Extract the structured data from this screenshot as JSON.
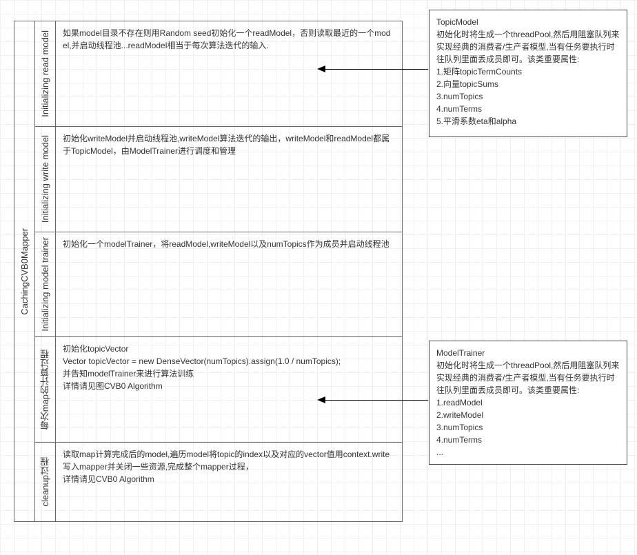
{
  "outer_title": "CachingCVB0Mapper",
  "rows": [
    {
      "title": "Initializing read model",
      "content": "如果model目录不存在则用Random seed初始化一个readModel，否则读取最近的一个model,并启动线程池...readModel相当于每次算法迭代的输入."
    },
    {
      "title": "Initializing write model",
      "content": "初始化writeModel并启动线程池,writeModel算法迭代的输出，writeModel和readModel都属于TopicModel，由ModelTrainer进行调度和管理"
    },
    {
      "title": "Initializing model trainer",
      "content": "初始化一个modelTrainer，将readModel,writeModel以及numTopics作为成员并启动线程池"
    },
    {
      "title": "每次map的计算过程",
      "content": "初始化topicVector\nVector topicVector = new DenseVector(numTopics).assign(1.0 / numTopics);\n并告知modelTrainer来进行算法训练\n详情请见图CVB0 Algorithm"
    },
    {
      "title": "cleanup过程",
      "content": "读取map计算完成后的model,遍历model将topic的index以及对应的vector值用context.write写入mapper并关闭一些资源,完成整个mapper过程，\n详情请见CVB0 Algorithm"
    }
  ],
  "side_top": {
    "title": "TopicModel",
    "body": "初始化时将生成一个threadPool,然后用阻塞队列来实现经典的消费者/生产者模型,当有任务要执行时往队列里面丢成员即可。该类重要属性:",
    "items": [
      "1.矩阵topicTermCounts",
      "2.向量topicSums",
      "3.numTopics",
      "4.numTerms",
      "5.平滑系数eta和alpha"
    ]
  },
  "side_bot": {
    "title": "ModelTrainer",
    "body": "初始化时将生成一个threadPool,然后用阻塞队列来实现经典的消费者/生产者模型,当有任务要执行时往队列里面丢成员即可。该类重要属性:",
    "items": [
      "1.readModel",
      "2.writeModel",
      "3.numTopics",
      "4.numTerms",
      "..."
    ]
  }
}
